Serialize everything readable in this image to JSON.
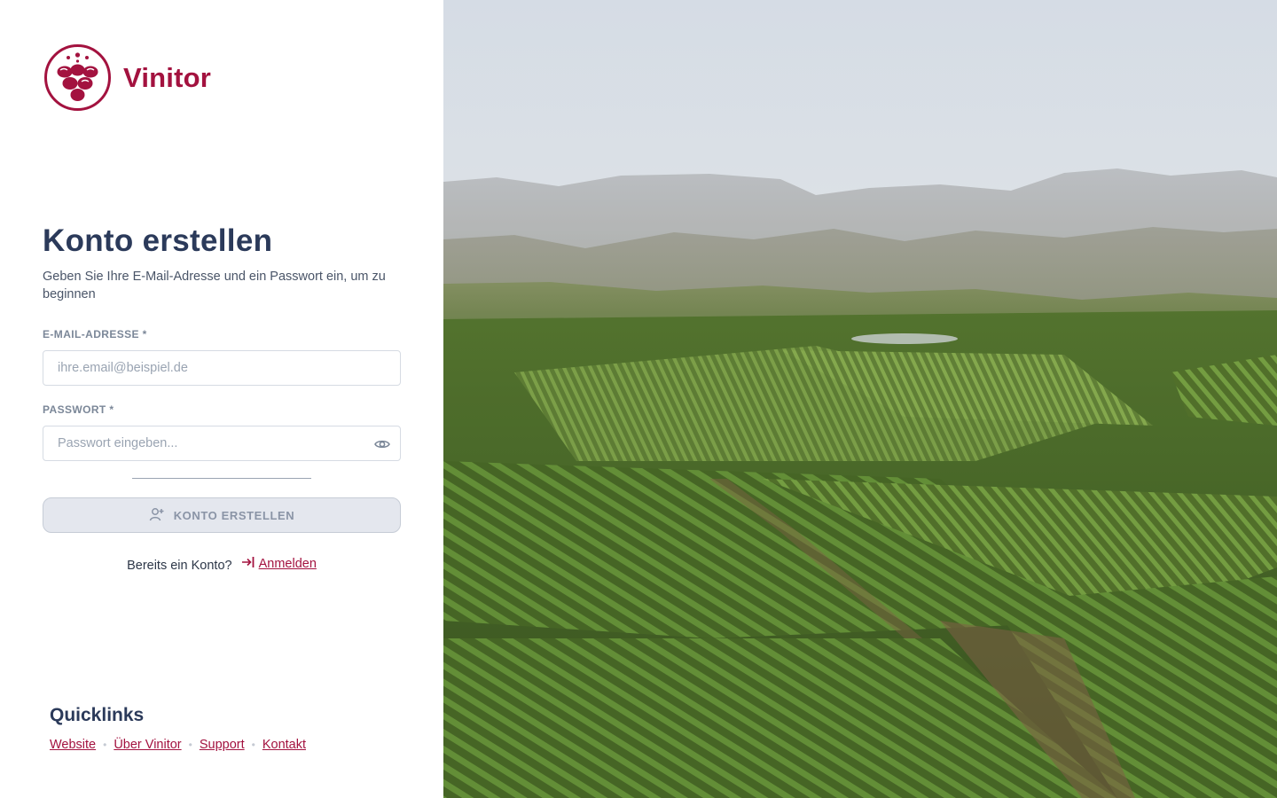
{
  "brand": {
    "name": "Vinitor",
    "color": "#a3123f",
    "icon": "grape-logo-icon"
  },
  "form": {
    "title": "Konto erstellen",
    "subtitle": "Geben Sie Ihre E-Mail-Adresse und ein Passwort ein, um zu beginnen",
    "email": {
      "label": "E-MAIL-ADRESSE *",
      "placeholder": "ihre.email@beispiel.de",
      "value": ""
    },
    "password": {
      "label": "PASSWORT *",
      "placeholder": "Passwort eingeben...",
      "value": "",
      "toggle_icon": "eye-icon"
    },
    "submit": {
      "label": "KONTO ERSTELLEN",
      "icon": "user-plus-icon",
      "disabled": true
    },
    "signin_prompt": "Bereits ein Konto?",
    "signin_link": "Anmelden",
    "signin_icon": "login-arrow-icon"
  },
  "quicklinks": {
    "title": "Quicklinks",
    "links": [
      "Website",
      "Über Vinitor",
      "Support",
      "Kontakt"
    ]
  },
  "hero": {
    "subject": "aerial-vineyard-landscape"
  }
}
